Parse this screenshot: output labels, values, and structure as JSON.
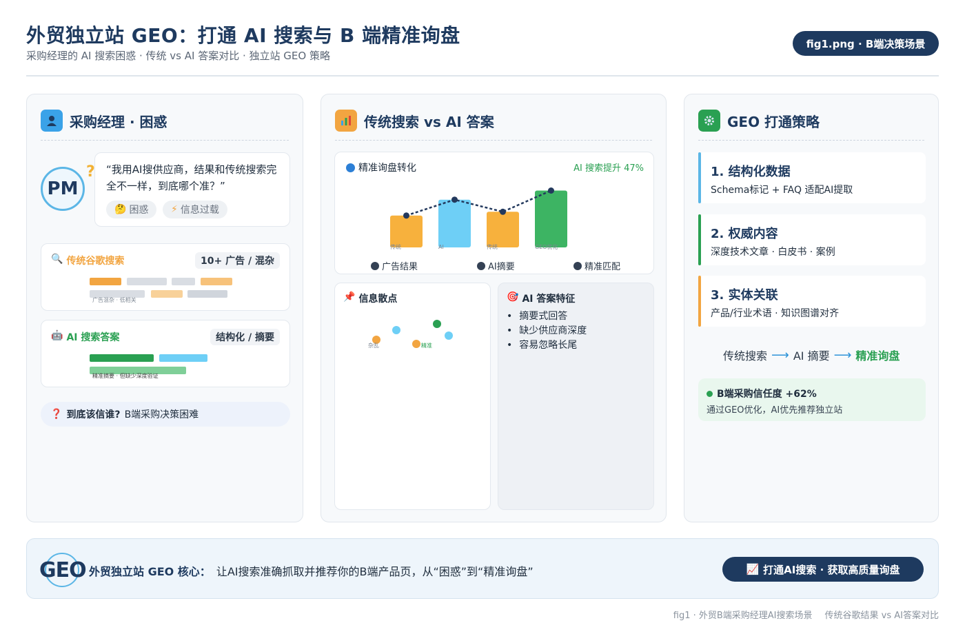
{
  "header": {
    "title": "外贸独立站 GEO：打通 AI 搜索与 B 端精准询盘",
    "subtitle": "采购经理的 AI 搜索困惑 · 传统 vs AI 答案对比 · 独立站 GEO 策略",
    "fig_pill": "fig1.png · B端决策场景"
  },
  "card1": {
    "title": "采购经理 · 困惑",
    "icon": "person-icon",
    "avatar": "PM",
    "avatar_mark": "?",
    "quote": "“我用AI搜供应商，结果和传统搜索完全不一样，到底哪个准？”",
    "chips": [
      {
        "emoji": "🤔",
        "label": "困惑"
      },
      {
        "emoji": "⚡",
        "label": "信息过载"
      }
    ],
    "traditional": {
      "emoji": "🔍",
      "title": "传统谷歌搜索",
      "tag": "10+ 广告 / 混杂",
      "caption": "广告混杂 · 低相关",
      "color": "#f2a541"
    },
    "ai": {
      "emoji": "🤖",
      "title": "AI 搜索答案",
      "tag": "结构化 / 摘要",
      "caption": "精准摘要 · 但缺少深度验证",
      "color": "#2aa052"
    },
    "question": {
      "emoji": "❓",
      "bold": "到底该信谁?",
      "text": "B端采购决策困难"
    }
  },
  "card2": {
    "title": "传统搜索 vs AI 答案",
    "icon": "chart-icon",
    "chart_data": {
      "type": "bar",
      "title": "精准询盘转化",
      "annotation": "AI 搜索提升 47%",
      "categories": [
        "传统",
        "AI",
        "传统",
        "GEO优化"
      ],
      "values": [
        0.42,
        0.63,
        0.47,
        0.75
      ],
      "colors": [
        "#f7b13d",
        "#6ecff6",
        "#f7b13d",
        "#3db463"
      ],
      "trend_line": true,
      "legend": [
        "广告结果",
        "AI摘要",
        "精准匹配"
      ]
    },
    "info": {
      "emoji": "📌",
      "title": "信息散点",
      "labels": [
        "杂乱",
        "精准"
      ],
      "points": [
        {
          "color": "#f2a541"
        },
        {
          "color": "#6ecff6"
        },
        {
          "color": "#f2a541"
        },
        {
          "color": "#2aa052"
        },
        {
          "color": "#6ecff6"
        }
      ]
    },
    "ai_features": {
      "emoji": "🎯",
      "title": "AI 答案特征",
      "items": [
        "摘要式回答",
        "缺少供应商深度",
        "容易忽略长尾"
      ]
    }
  },
  "card3": {
    "title": "GEO 打通策略",
    "icon": "gear-icon",
    "steps": [
      {
        "title": "1. 结构化数据",
        "desc": "Schema标记 + FAQ 适配AI提取",
        "color": "#5bb6e6"
      },
      {
        "title": "2. 权威内容",
        "desc": "深度技术文章 · 白皮书 · 案例",
        "color": "#2aa052"
      },
      {
        "title": "3. 实体关联",
        "desc": "产品/行业术语 · 知识图谱对齐",
        "color": "#f2a541"
      }
    ],
    "flow": [
      "传统搜索",
      "AI 摘要",
      "精准询盘"
    ],
    "trust": {
      "title": "B端采购信任度 +62%",
      "desc": "通过GEO优化，AI优先推荐独立站"
    }
  },
  "bottom": {
    "logo": "GEO",
    "lead": "外贸独立站 GEO 核心：",
    "text": "让AI搜索准确抓取并推荐你的B端产品页，从“困惑”到“精准询盘”",
    "button": {
      "emoji": "📈",
      "label": "打通AI搜索 · 获取高质量询盘"
    }
  },
  "caption": {
    "left": "fig1 · 外贸B端采购经理AI搜索场景",
    "right": "传统谷歌结果 vs AI答案对比"
  }
}
